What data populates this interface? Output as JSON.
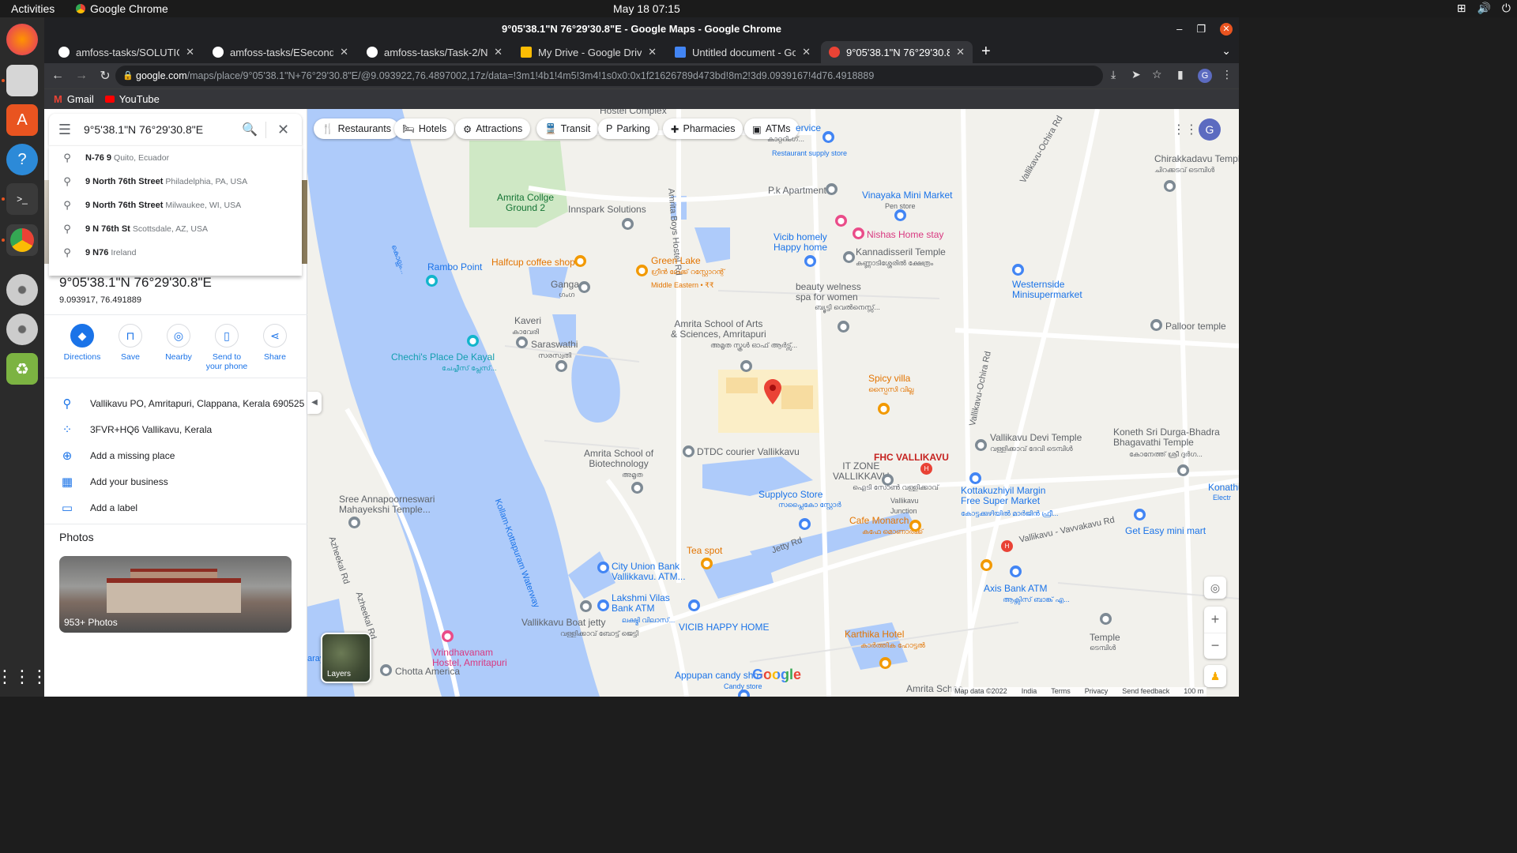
{
  "os": {
    "activities": "Activities",
    "app_name": "Google Chrome",
    "clock": "May 18  07:15"
  },
  "window": {
    "title": "9°05'38.1\"N 76°29'30.8\"E - Google Maps - Google Chrome"
  },
  "tabs": [
    {
      "label": "amfoss-tasks/SOLUTION.",
      "color": "#ffffff"
    },
    {
      "label": "amfoss-tasks/ESeconds.t",
      "color": "#ffffff"
    },
    {
      "label": "amfoss-tasks/Task-2/Nor",
      "color": "#ffffff"
    },
    {
      "label": "My Drive - Google Drive",
      "color": "#fbbc04"
    },
    {
      "label": "Untitled document - Goog",
      "color": "#4285f4"
    },
    {
      "label": "9°05'38.1\"N 76°29'30.8\"E -",
      "color": "#ea4335"
    }
  ],
  "omnibox": {
    "host": "google.com",
    "path": "/maps/place/9°05'38.1\"N+76°29'30.8\"E/@9.093922,76.4897002,17z/data=!3m1!4b1!4m5!3m4!1s0x0:0x1f21626789d473bd!8m2!3d9.0939167!4d76.4918889"
  },
  "bookmarks": [
    {
      "label": "Gmail"
    },
    {
      "label": "YouTube"
    }
  ],
  "search": {
    "value": "9°5'38.1\"N 76°29'30.8\"E"
  },
  "suggestions": [
    {
      "main": "N-76 9",
      "sub": "Quito, Ecuador"
    },
    {
      "main": "9 North 76th Street",
      "sub": "Philadelphia, PA, USA"
    },
    {
      "main": "9 North 76th Street",
      "sub": "Milwaukee, WI, USA"
    },
    {
      "main": "9 N 76th St",
      "sub": "Scottsdale, AZ, USA"
    },
    {
      "main": "9 N76",
      "sub": "Ireland"
    }
  ],
  "place": {
    "title": "9°05'38.1\"N 76°29'30.8\"E",
    "decimal": "9.093917, 76.491889"
  },
  "actions": [
    {
      "label": "Directions",
      "icon": "directions-icon"
    },
    {
      "label": "Save",
      "icon": "bookmark-icon"
    },
    {
      "label": "Nearby",
      "icon": "nearby-icon"
    },
    {
      "label": "Send to your phone",
      "icon": "phone-icon"
    },
    {
      "label": "Share",
      "icon": "share-icon"
    }
  ],
  "info": {
    "address": "Vallikavu PO, Amritapuri, Clappana, Kerala 690525",
    "plus_code": "3FVR+HQ6 Vallikavu, Kerala",
    "add_missing": "Add a missing place",
    "add_business": "Add your business",
    "add_label": "Add a label"
  },
  "photos": {
    "title": "Photos",
    "count": "953+ Photos"
  },
  "chips": [
    {
      "label": "Restaurants",
      "icon": "🍴"
    },
    {
      "label": "Hotels",
      "icon": "🛏"
    },
    {
      "label": "Attractions",
      "icon": "⚙"
    },
    {
      "label": "Transit",
      "icon": "🚆"
    },
    {
      "label": "Parking",
      "icon": "P"
    },
    {
      "label": "Pharmacies",
      "icon": "✚"
    },
    {
      "label": "ATMs",
      "icon": "▣"
    }
  ],
  "map_labels": {
    "hostel_complex": "Hostel Complex",
    "service": "ervice",
    "restaurant_supply": "Restaurant supply store",
    "malayalam_1": "കാറ്ററിംഗ്...",
    "amrita_ground": "Amrita Collge\nGround 2",
    "amrita_boys_hostel_rd": "Amrita Boys Hostel Rd",
    "pk_apartment": "P.k Apartment",
    "vinayaka": "Vinayaka Mini Market",
    "pen_store": "Pen store",
    "vallikavu_ochira_rd": "Vallikavu-Ochira Rd",
    "chirakkadavu": "Chirakkadavu Temple",
    "chirakkadavu_ml": "ചിറക്കടവ് ടെമ്പിൾ",
    "innspark": "Innspark Solutions",
    "nishas": "Nishas Home stay",
    "vicib_homely": "Vicib homely\nHappy home",
    "kannadisseril": "Kannadisseril Temple",
    "kannadisseril_ml": "കണ്ണാടിശ്ശേരിൽ ക്ഷേത്രം",
    "rambo_point": "Rambo Point",
    "halfcup": "Halfcup coffee shop",
    "green_lake": "Green Lake",
    "green_lake_ml": "ഗ്രീൻ ലേക്ക് റസ്റ്റോറന്റ്",
    "middle_eastern": "Middle Eastern • ₹₹",
    "ganga": "Ganga",
    "ganga_ml": "ഗംഗ",
    "westerside": "Westernside\nMinisupermarket",
    "beauty_welness": "beauty welness\nspa for women",
    "beauty_ml": "ബ്യൂട്ടി വെൽനെസ്സ്...",
    "palloor": "Palloor temple",
    "kaveri": "Kaveri",
    "kaveri_ml": "കാവേരി",
    "saraswathi": "Saraswathi",
    "saraswathi_ml": "സരസ്വതി",
    "amrita_arts": "Amrita School of Arts\n& Sciences, Amritapuri",
    "amrita_arts_ml": "അമൃത സ്കൂൾ ഓഫ് ആർട്സ്...",
    "chechis": "Chechi's Place De Kayal",
    "chechis_ml": "ചേച്ചീസ് പ്ലേസ്...",
    "spicy_villa": "Spicy villa",
    "spicy_villa_ml": "സ്പൈസി വില്ല",
    "vallikavu_ochira_rd2": "Vallikavu-Ochira Rd",
    "koneth": "Koneth Sri Durga-Bhadra\nBhagavathi Temple",
    "koneth_ml": "കോനേത്ത് ശ്രീ ദുർഗ...",
    "vallikavu_devi": "Vallikavu Devi Temple",
    "vallikavu_devi_ml": "വള്ളിക്കാവ് ദേവി ടെമ്പിൾ",
    "amrita_biotech": "Amrita School of\nBiotechnology",
    "amrita_biotech_ml": "അമൃത",
    "dtdc": "DTDC courier Vallikkavu",
    "fhc": "FHC VALLIKAVU",
    "it_zone": "IT ZONE\nVALLIKKAVU",
    "it_zone_ml": "ഐടി സോൺ വള്ളിക്കാവ്",
    "sree_annapoorneswari": "Sree Annapoorneswari\nMahayekshi Temple...",
    "supplyco": "Supplyco Store",
    "supplyco_ml": "സപ്ലൈകോ സ്റ്റോർ",
    "vallikavu_junction": "Vallikavu\nJunction",
    "kottakuzhiyil": "Kottakuzhiyil Margin\nFree Super Market",
    "kottakuzhiyil_ml": "കോട്ടക്കുഴിയിൽ മാർജിൻ ഫ്രീ...",
    "konathu": "Konathu",
    "konathu_sub": "Electr",
    "cafe_monarch": "Cafe Monarch",
    "cafe_monarch_ml": "കഫേ മൊണാർക്ക്",
    "get_easy": "Get Easy mini mart",
    "azheekal_rd": "Azheekal Rd",
    "kollam_waterway": "Kollam-Kottapuram Waterway",
    "vallikavu_vavvakavu_rd": "Vallikavu - Vavvakavu Rd",
    "tea_spot": "Tea spot",
    "jetty_rd": "Jetty Rd",
    "city_union": "City Union Bank\nVallikkavu. ATM...",
    "axis_bank": "Axis Bank ATM",
    "axis_bank_ml": "ആക്സിസ് ബാങ്ക് എ...",
    "lakshmi_vilas": "Lakshmi Vilas\nBank ATM",
    "lakshmi_vilas_ml": "ലക്ഷ്മി വിലാസ്...",
    "azheekal_rd2": "Azheekal Rd",
    "vallikkavu_boat": "Vallikkavu Boat jetty",
    "vallikkavu_boat_ml": "വള്ളിക്കാവ് ബോട്ട് ജെട്ടി",
    "vicib_happy": "VICIB HAPPY HOME",
    "temple": "Temple",
    "temple_ml": "ടെമ്പിൾ",
    "vrindhavanam": "Vrindhavanam\nHostel, Amritapuri",
    "karthika": "Karthika Hotel",
    "karthika_ml": "കാർത്തിക ഹോട്ടൽ",
    "chotta_america": "Chotta America",
    "appupan": "Appupan candy sho",
    "candy_store": "Candy store",
    "amrita_school_bottom": "Amrita Schoo",
    "waterway_ml": "കൊല്ലം...",
    "aray": "aray"
  },
  "map_ui": {
    "layers": "Layers",
    "google": "Google",
    "avatar": "G",
    "footer": [
      "Map data ©2022",
      "India",
      "Terms",
      "Privacy",
      "Send feedback",
      "100 m"
    ]
  }
}
